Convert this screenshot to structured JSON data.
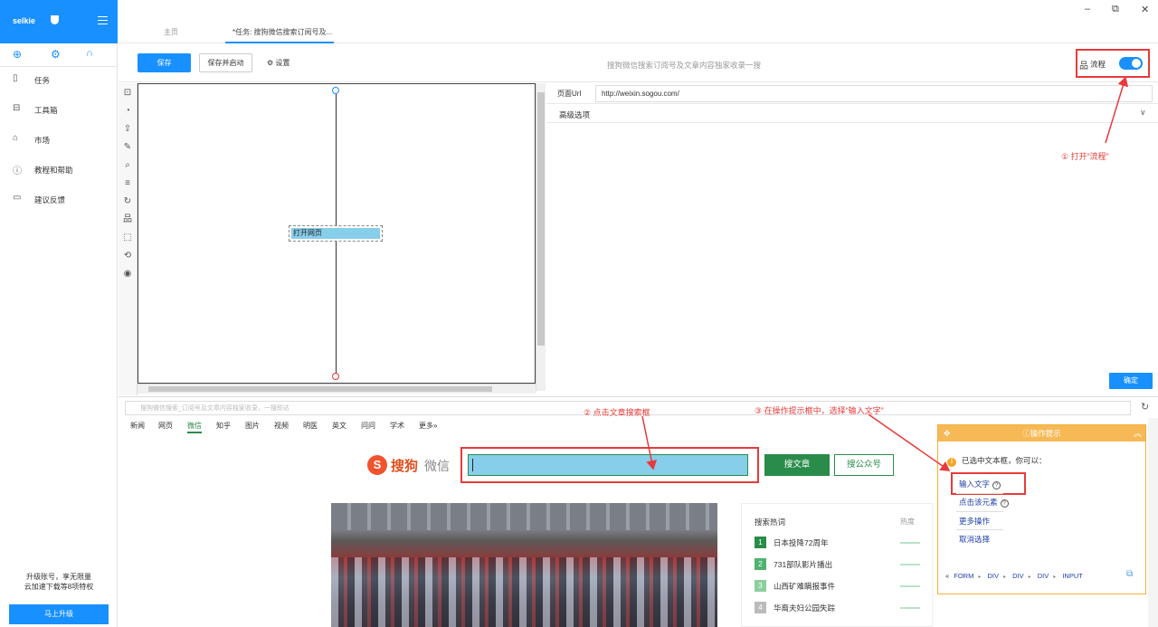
{
  "sidebar": {
    "brand": "selkie",
    "quick_icons": [
      "add-circle-icon",
      "gear-icon",
      "headset-icon"
    ],
    "items": [
      {
        "label": "任务",
        "icon": "document-icon"
      },
      {
        "label": "工具箱",
        "icon": "toolbox-icon"
      },
      {
        "label": "市场",
        "icon": "shopping-bag-icon"
      },
      {
        "label": "教程和帮助",
        "icon": "help-icon"
      },
      {
        "label": "建议反馈",
        "icon": "feedback-icon"
      }
    ],
    "upgrade_line1": "升级账号，享无限量",
    "upgrade_line2": "云加速下载等8项特权",
    "upgrade_button": "马上升级"
  },
  "tabs": [
    {
      "label": "主页"
    },
    {
      "label": "*任务: 搜狗微信搜索订阅号及..."
    }
  ],
  "toolbar": {
    "save": "保存",
    "save_and_run": "保存并启动",
    "settings": "设置",
    "center_title": "搜狗微信搜索订阅号及文章内容独家收录一搜",
    "flow_label": "流程",
    "flow_enabled": true
  },
  "canvas": {
    "node_label": "打开网页"
  },
  "props": {
    "url_label": "页面Url",
    "url_value": "http://weixin.sogou.com/",
    "advanced": "高级选项",
    "ok": "确定"
  },
  "browser": {
    "address": "搜狗微信搜索_订阅号及文章内容独家收录，一搜即达",
    "nav": [
      "新闻",
      "网页",
      "微信",
      "知乎",
      "图片",
      "视频",
      "明医",
      "英文",
      "问问",
      "学术",
      "更多»"
    ],
    "logo_brand": "搜狗",
    "logo_weixin": "微信",
    "search_article_btn": "搜文章",
    "search_account_btn": "搜公众号",
    "hot_title": "搜索热词",
    "hot_heat": "热度",
    "hot_items": [
      {
        "rank": "1",
        "text": "日本投降72周年"
      },
      {
        "rank": "2",
        "text": "731部队影片播出"
      },
      {
        "rank": "3",
        "text": "山西矿难瞒报事件"
      },
      {
        "rank": "4",
        "text": "华裔夫妇公园失踪"
      }
    ]
  },
  "tips": {
    "title": "操作提示",
    "message": "已选中文本框，你可以：",
    "options": [
      "输入文字",
      "点击该元素",
      "更多操作",
      "取消选择"
    ],
    "crumbs": [
      "FORM",
      "DIV",
      "DIV",
      "DIV",
      "INPUT"
    ]
  },
  "annotations": {
    "a1": "① 打开“流程”",
    "a2": "② 点击文章搜索框",
    "a3": "③ 在操作提示框中，选择“输入文字”"
  },
  "colors": {
    "primary": "#1890ff",
    "annotation": "#e83a3a",
    "sogou_green": "#2a8c4a",
    "tips_header": "#f7b955"
  }
}
